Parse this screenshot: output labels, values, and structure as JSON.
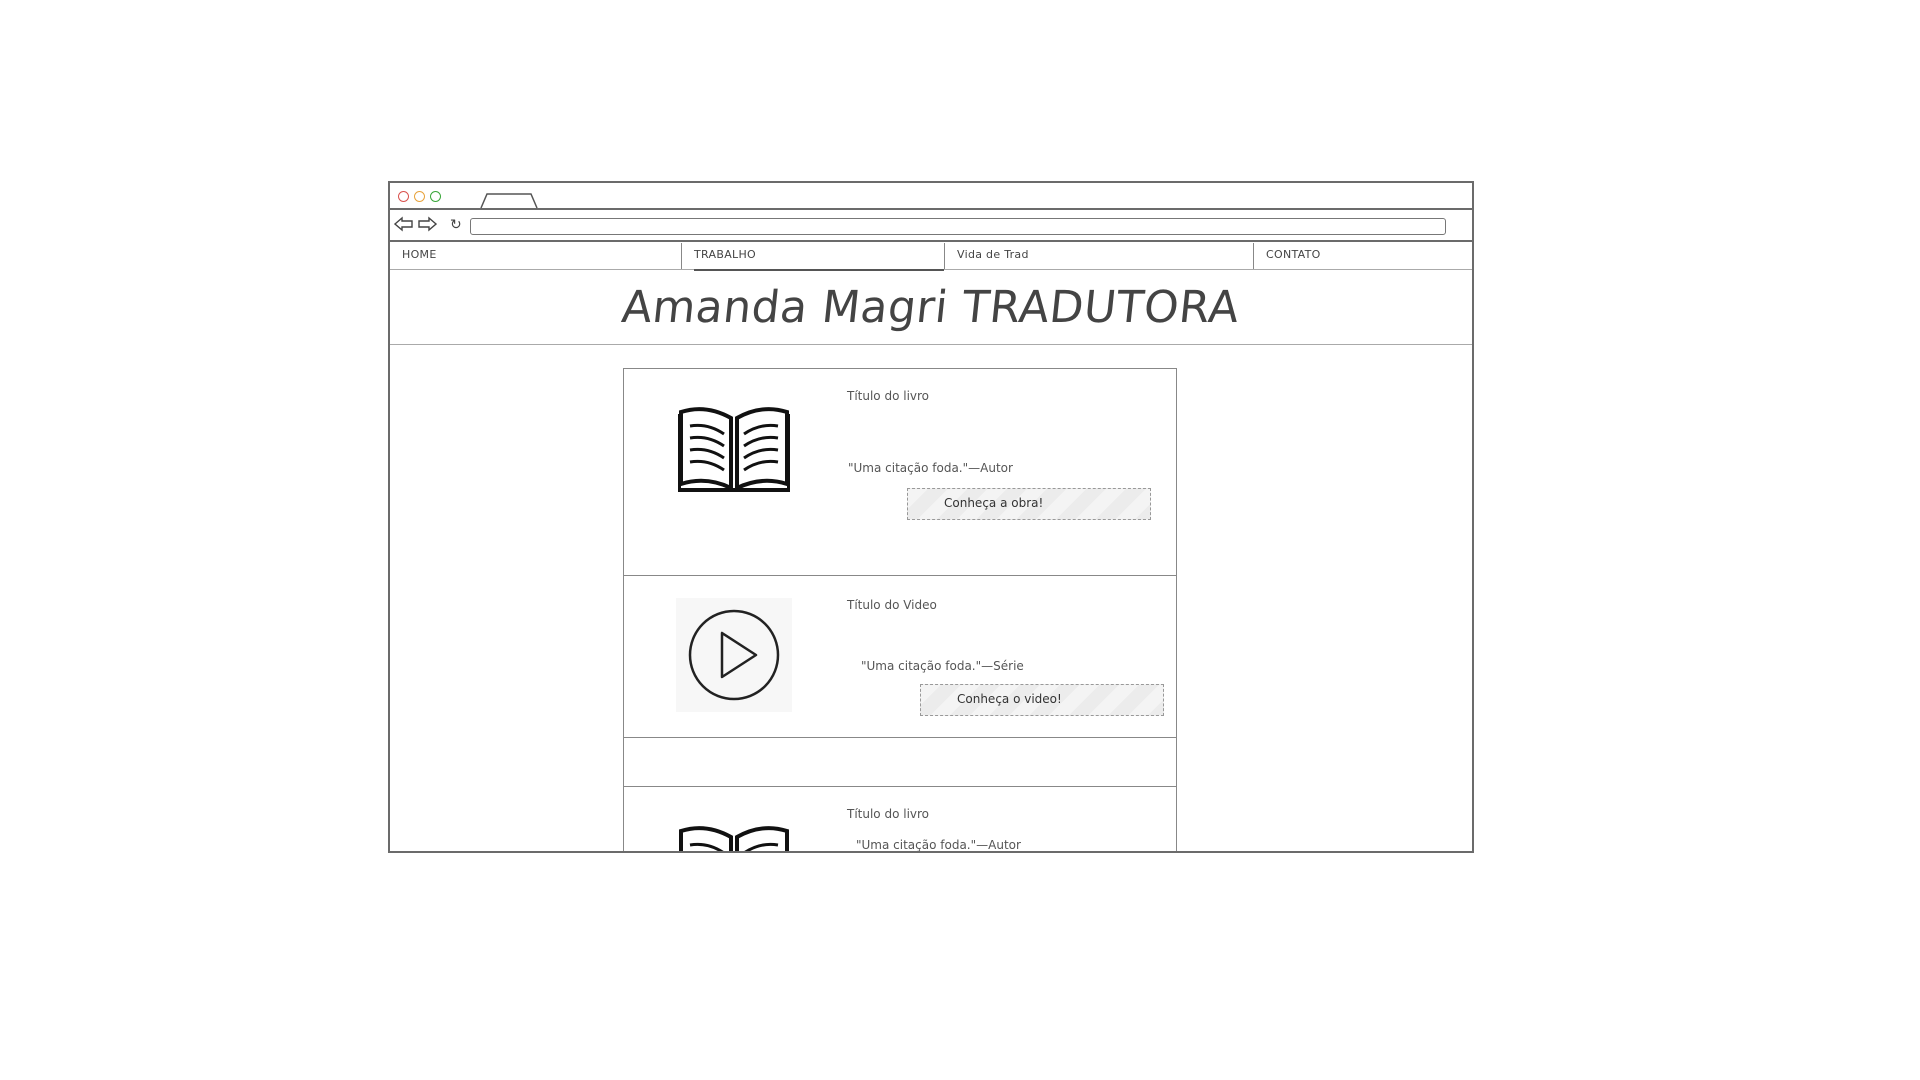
{
  "window": {
    "controls": [
      "close",
      "minimize",
      "maximize"
    ],
    "url": ""
  },
  "nav": {
    "items": [
      {
        "label": "HOME"
      },
      {
        "label": "TRABALHO"
      },
      {
        "label": "Vida de Trad"
      },
      {
        "label": "CONTATO"
      }
    ],
    "active": "TRABALHO"
  },
  "header": {
    "title": "Amanda Magri TRADUTORA"
  },
  "cards": [
    {
      "icon": "open-book-icon",
      "title": "Título do livro",
      "quote": "\"Uma citação foda.\"—Autor",
      "button": "Conheça a obra!"
    },
    {
      "icon": "play-icon",
      "title": "Título do Video",
      "quote": "\"Uma citação foda.\"—Série",
      "button": "Conheça o video!"
    },
    {
      "icon": "open-book-icon",
      "title": "Título do livro",
      "quote": "\"Uma citação foda.\"—Autor"
    }
  ],
  "colors": {
    "close": "#d9534f",
    "minimize": "#e8a33c",
    "maximize": "#3aa63a",
    "frame": "#6b6b6b"
  }
}
